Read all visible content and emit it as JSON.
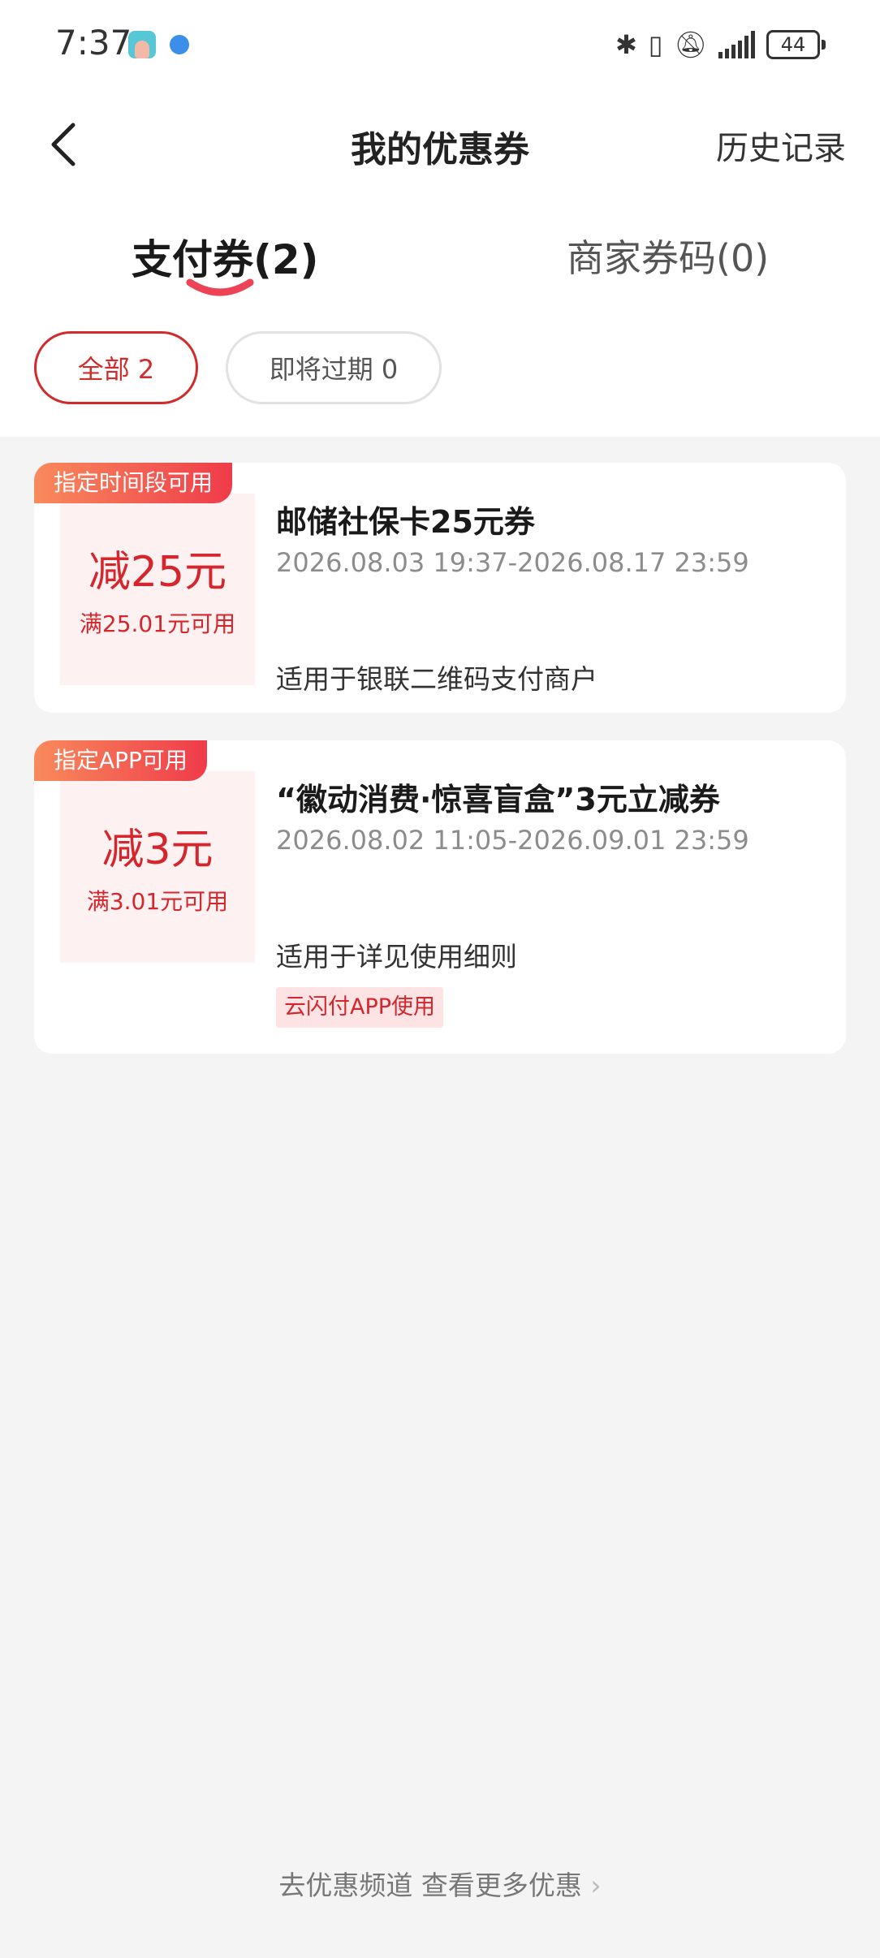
{
  "status_bar": {
    "time": "7:37",
    "battery": "44",
    "icons": [
      "bluetooth-icon",
      "vibrate-icon",
      "mute-icon",
      "signal-icon",
      "battery-icon"
    ]
  },
  "header": {
    "title": "我的优惠券",
    "history_label": "历史记录"
  },
  "tabs": [
    {
      "label": "支付券(2)",
      "active": true
    },
    {
      "label": "商家券码(0)",
      "active": false
    }
  ],
  "filters": [
    {
      "label": "全部 2",
      "active": true
    },
    {
      "label": "即将过期 0",
      "active": false
    }
  ],
  "coupons": [
    {
      "tag": "指定时间段可用",
      "amount": "减25元",
      "threshold": "满25.01元可用",
      "title": "邮储社保卡25元券",
      "period": "2026.08.03 19:37-2026.08.17 23:59",
      "scope": "适用于银联二维码支付商户"
    },
    {
      "tag": "指定APP可用",
      "amount": "减3元",
      "threshold": "满3.01元可用",
      "title": "“徽动消费·惊喜盲盒”3元立减券",
      "period": "2026.08.02 11:05-2026.09.01 23:59",
      "scope": "适用于详见使用细则",
      "badge": "云闪付APP使用"
    }
  ],
  "footer": {
    "link": "去优惠频道 查看更多优惠"
  },
  "colors": {
    "accent": "#d4262c",
    "tag_gradient_start": "#f98a5c",
    "tag_gradient_end": "#ef3b4a"
  }
}
